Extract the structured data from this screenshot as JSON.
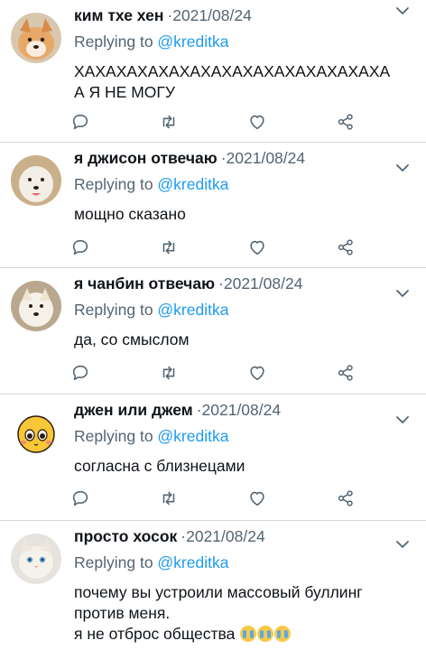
{
  "colors": {
    "accent": "#1d9bf0",
    "muted": "#536471",
    "divider": "#cfd9de",
    "text": "#0f1419"
  },
  "icons": {
    "reply": "comment-bubble-icon",
    "retweet": "retweet-icon",
    "like": "heart-icon",
    "share": "share-icon",
    "menu": "chevron-down-icon"
  },
  "tweets": [
    {
      "name": "ким тхе хен",
      "date": "2021/08/24",
      "replying_prefix": "Replying to ",
      "replying_handle": "@kreditka",
      "lines": [
        "ХАХАХАХАХАХАХАХАХАХАХАХАХАХАХА",
        "А Я НЕ МОГУ"
      ]
    },
    {
      "name": "я джисон отвечаю",
      "date": "2021/08/24",
      "replying_prefix": "Replying to ",
      "replying_handle": "@kreditka",
      "lines": [
        "мощно сказано"
      ]
    },
    {
      "name": "я чанбин отвечаю",
      "date": "2021/08/24",
      "replying_prefix": "Replying to ",
      "replying_handle": "@kreditka",
      "lines": [
        "да, со смыслом"
      ]
    },
    {
      "name": "джен или джем",
      "date": "2021/08/24",
      "replying_prefix": "Replying to ",
      "replying_handle": "@kreditka",
      "lines": [
        "согласна с близнецами"
      ]
    },
    {
      "name": "просто хосок",
      "date": "2021/08/24",
      "replying_prefix": "Replying to ",
      "replying_handle": "@kreditka",
      "lines": [
        "почему вы устроили массовый буллинг",
        "против меня.",
        "я не отброс общества"
      ],
      "trailing_emoji": "crying-face-emoji"
    }
  ]
}
